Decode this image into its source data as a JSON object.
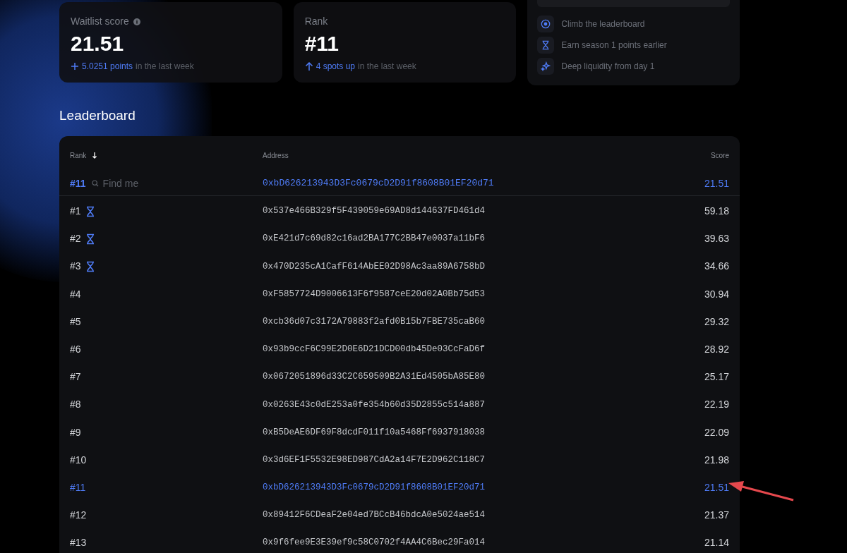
{
  "stats": [
    {
      "label": "Waitlist score",
      "info": true,
      "value": "21.51",
      "kind": "plus",
      "delta": "5.0251 points",
      "delta_suffix": "in the last week"
    },
    {
      "label": "Rank",
      "info": false,
      "value": "#11",
      "kind": "arrow-up",
      "delta": "4 spots up",
      "delta_suffix": "in the last week"
    }
  ],
  "perks": [
    {
      "kind": "target",
      "label": "Climb the leaderboard"
    },
    {
      "kind": "hourglass",
      "label": "Earn season 1 points earlier"
    },
    {
      "kind": "sparkles",
      "label": "Deep liquidity from day 1"
    }
  ],
  "leaderboard": {
    "title": "Leaderboard",
    "columns": [
      "Rank",
      "Address",
      "Score"
    ],
    "me": {
      "rank": "#11",
      "find_placeholder": "Find me",
      "address": "0xbD626213943D3Fc0679cD2D91f8608B01EF20d71",
      "score": "21.51"
    },
    "rows": [
      {
        "rank": "#1",
        "trophy": true,
        "address": "0x537e466B329f5F439059e69AD8d144637FD461d4",
        "score": "59.18",
        "selected": false
      },
      {
        "rank": "#2",
        "trophy": true,
        "address": "0xE421d7c69d82c16ad2BA177C2BB47e0037a11bF6",
        "score": "39.63",
        "selected": false
      },
      {
        "rank": "#3",
        "trophy": true,
        "address": "0x470D235cA1CafF614AbEE02D98Ac3aa89A6758bD",
        "score": "34.66",
        "selected": false
      },
      {
        "rank": "#4",
        "trophy": false,
        "address": "0xF5857724D9006613F6f9587ceE20d02A0Bb75d53",
        "score": "30.94",
        "selected": false
      },
      {
        "rank": "#5",
        "trophy": false,
        "address": "0xcb36d07c3172A79883f2afd0B15b7FBE735caB60",
        "score": "29.32",
        "selected": false
      },
      {
        "rank": "#6",
        "trophy": false,
        "address": "0x93b9ccF6C99E2D0E6D21DCD00db45De03CcFaD6f",
        "score": "28.92",
        "selected": false
      },
      {
        "rank": "#7",
        "trophy": false,
        "address": "0x0672051896d33C2C659509B2A31Ed4505bA85E80",
        "score": "25.17",
        "selected": false
      },
      {
        "rank": "#8",
        "trophy": false,
        "address": "0x0263E43c0dE253a0fe354b60d35D2855c514a887",
        "score": "22.19",
        "selected": false
      },
      {
        "rank": "#9",
        "trophy": false,
        "address": "0xB5DeAE6DF69F8dcdF011f10a5468Ff6937918038",
        "score": "22.09",
        "selected": false
      },
      {
        "rank": "#10",
        "trophy": false,
        "address": "0x3d6EF1F5532E98ED987CdA2a14F7E2D962C118C7",
        "score": "21.98",
        "selected": false
      },
      {
        "rank": "#11",
        "trophy": false,
        "address": "0xbD626213943D3Fc0679cD2D91f8608B01EF20d71",
        "score": "21.51",
        "selected": true
      },
      {
        "rank": "#12",
        "trophy": false,
        "address": "0x89412F6CDeaF2e04ed7BCcB46bdcA0e5024ae514",
        "score": "21.37",
        "selected": false
      },
      {
        "rank": "#13",
        "trophy": false,
        "address": "0x9f6fee9E3E39ef9c58C0702f4AA4C6Bec29Fa014",
        "score": "21.14",
        "selected": false
      }
    ]
  }
}
